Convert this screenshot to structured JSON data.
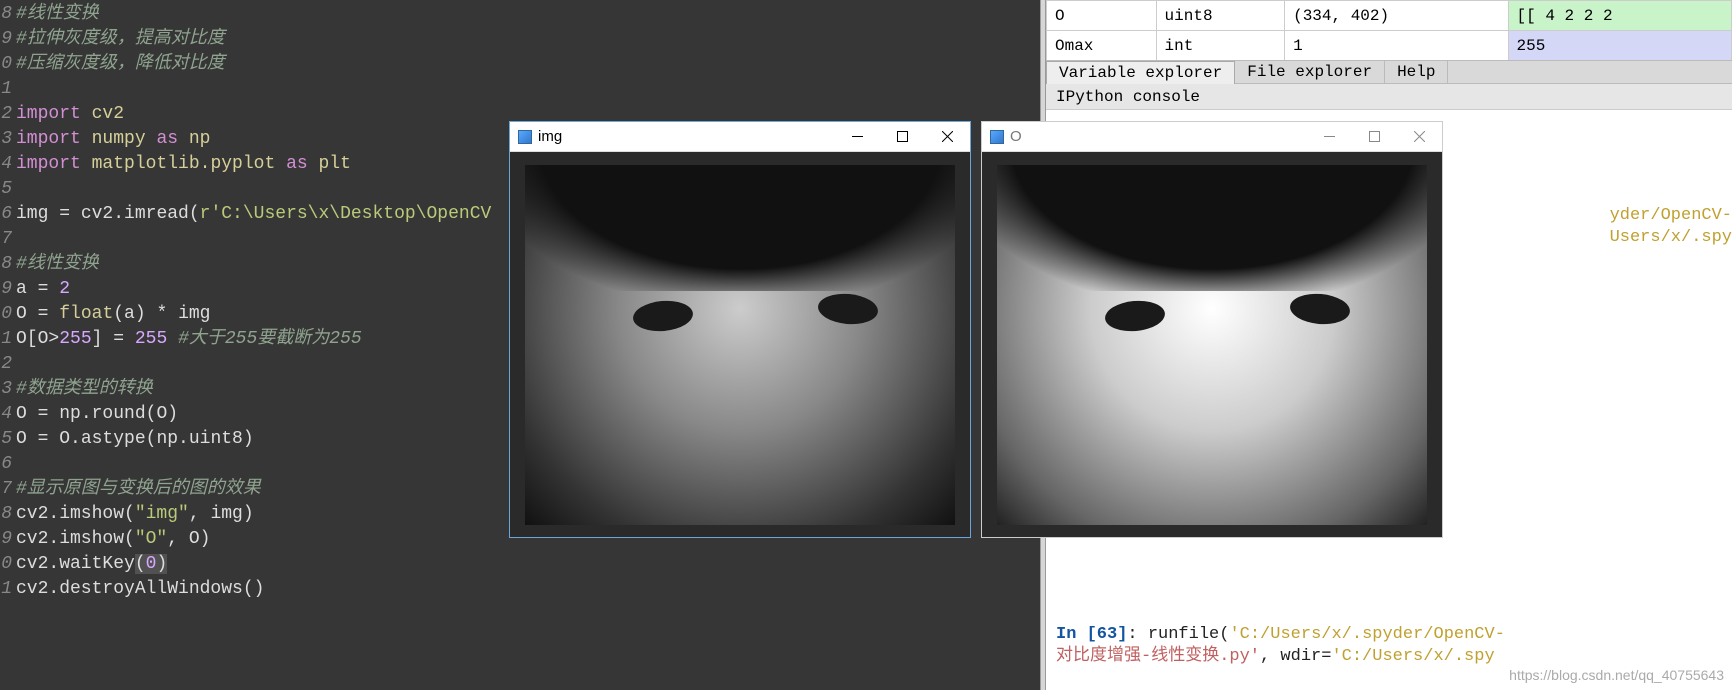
{
  "editor": {
    "lines": [
      {
        "n": "8",
        "frags": [
          {
            "cls": "c-comment",
            "t": "#线性变换"
          }
        ]
      },
      {
        "n": "9",
        "frags": [
          {
            "cls": "c-comment",
            "t": "#拉伸灰度级，提高对比度"
          }
        ]
      },
      {
        "n": "0",
        "frags": [
          {
            "cls": "c-comment",
            "t": "#压缩灰度级，降低对比度"
          }
        ]
      },
      {
        "n": "1",
        "frags": []
      },
      {
        "n": "2",
        "frags": [
          {
            "cls": "c-key",
            "t": "import"
          },
          {
            "t": " "
          },
          {
            "cls": "c-name",
            "t": "cv2"
          }
        ]
      },
      {
        "n": "3",
        "frags": [
          {
            "cls": "c-key",
            "t": "import"
          },
          {
            "t": " "
          },
          {
            "cls": "c-name",
            "t": "numpy"
          },
          {
            "t": " "
          },
          {
            "cls": "c-key",
            "t": "as"
          },
          {
            "t": " "
          },
          {
            "cls": "c-name",
            "t": "np"
          }
        ]
      },
      {
        "n": "4",
        "frags": [
          {
            "cls": "c-key",
            "t": "import"
          },
          {
            "t": " "
          },
          {
            "cls": "c-name",
            "t": "matplotlib.pyplot"
          },
          {
            "t": " "
          },
          {
            "cls": "c-key",
            "t": "as"
          },
          {
            "t": " "
          },
          {
            "cls": "c-name",
            "t": "plt"
          }
        ]
      },
      {
        "n": "5",
        "frags": []
      },
      {
        "n": "6",
        "frags": [
          {
            "t": "img "
          },
          {
            "cls": "",
            "t": "="
          },
          {
            "t": " cv2.imread("
          },
          {
            "cls": "c-str",
            "t": "r'C:\\Users\\x\\Desktop\\OpenCV"
          }
        ]
      },
      {
        "n": "7",
        "frags": []
      },
      {
        "n": "8",
        "frags": [
          {
            "cls": "c-comment",
            "t": "#线性变换"
          }
        ]
      },
      {
        "n": "9",
        "frags": [
          {
            "t": "a "
          },
          {
            "t": "="
          },
          {
            "t": " "
          },
          {
            "cls": "c-num",
            "t": "2"
          }
        ]
      },
      {
        "n": "0",
        "frags": [
          {
            "t": "O "
          },
          {
            "t": "="
          },
          {
            "t": " "
          },
          {
            "cls": "c-func",
            "t": "float"
          },
          {
            "t": "(a) "
          },
          {
            "t": "*"
          },
          {
            "t": " img"
          }
        ]
      },
      {
        "n": "1",
        "frags": [
          {
            "t": "O[O"
          },
          {
            "t": ">"
          },
          {
            "cls": "c-num",
            "t": "255"
          },
          {
            "t": "] "
          },
          {
            "t": "="
          },
          {
            "t": " "
          },
          {
            "cls": "c-num",
            "t": "255"
          },
          {
            "t": " "
          },
          {
            "cls": "c-comment",
            "t": "#大于255要截断为255"
          }
        ]
      },
      {
        "n": "2",
        "frags": []
      },
      {
        "n": "3",
        "frags": [
          {
            "cls": "c-comment",
            "t": "#数据类型的转换"
          }
        ]
      },
      {
        "n": "4",
        "frags": [
          {
            "t": "O "
          },
          {
            "t": "="
          },
          {
            "t": " np.round(O)"
          }
        ]
      },
      {
        "n": "5",
        "frags": [
          {
            "t": "O "
          },
          {
            "t": "="
          },
          {
            "t": " O.astype(np.uint8)"
          }
        ]
      },
      {
        "n": "6",
        "frags": []
      },
      {
        "n": "7",
        "frags": [
          {
            "cls": "c-comment",
            "t": "#显示原图与变换后的图的效果"
          }
        ]
      },
      {
        "n": "8",
        "frags": [
          {
            "t": "cv2.imshow("
          },
          {
            "cls": "c-str",
            "t": "\"img\""
          },
          {
            "t": ", img)"
          }
        ]
      },
      {
        "n": "9",
        "frags": [
          {
            "t": "cv2.imshow("
          },
          {
            "cls": "c-str",
            "t": "\"O\""
          },
          {
            "t": ", O)"
          }
        ]
      },
      {
        "n": "0",
        "frags": [
          {
            "t": "cv2.waitKey"
          },
          {
            "cls": "cursor-box",
            "t": "("
          },
          {
            "cls": "c-num cursor-box",
            "t": "0"
          },
          {
            "cls": "cursor-box",
            "t": ")"
          }
        ]
      },
      {
        "n": "1",
        "frags": [
          {
            "t": "cv2.destroyAllWindows()"
          }
        ]
      }
    ]
  },
  "vars": {
    "rows": [
      {
        "name": "O",
        "type": "uint8",
        "size": "(334, 402)",
        "value": "[[ 4  2  2  2",
        "valcls": "vals-green"
      },
      {
        "name": "Omax",
        "type": "int",
        "size": "1",
        "value": "255",
        "valcls": "vals-purple"
      }
    ]
  },
  "tabs": {
    "items": [
      {
        "label": "Variable explorer",
        "active": true
      },
      {
        "label": "File explorer",
        "active": false
      },
      {
        "label": "Help",
        "active": false
      }
    ],
    "sub": "IPython console"
  },
  "console": {
    "frag1": "yder/OpenCV-",
    "frag2": "Users/x/.spy",
    "prompt_in": "In ",
    "prompt_num": "[63]",
    "prompt_colon": ": ",
    "cmd_a": "runfile(",
    "path_a": "'C:/Users/x/.spyder/OpenCV-",
    "cn": "对比度增强-线性变换.py'",
    "cmd_b": ", wdir=",
    "path_b": "'C:/Users/x/.spy"
  },
  "windows": {
    "img": {
      "title": "img"
    },
    "O": {
      "title": "O"
    }
  },
  "watermark": "https://blog.csdn.net/qq_40755643"
}
